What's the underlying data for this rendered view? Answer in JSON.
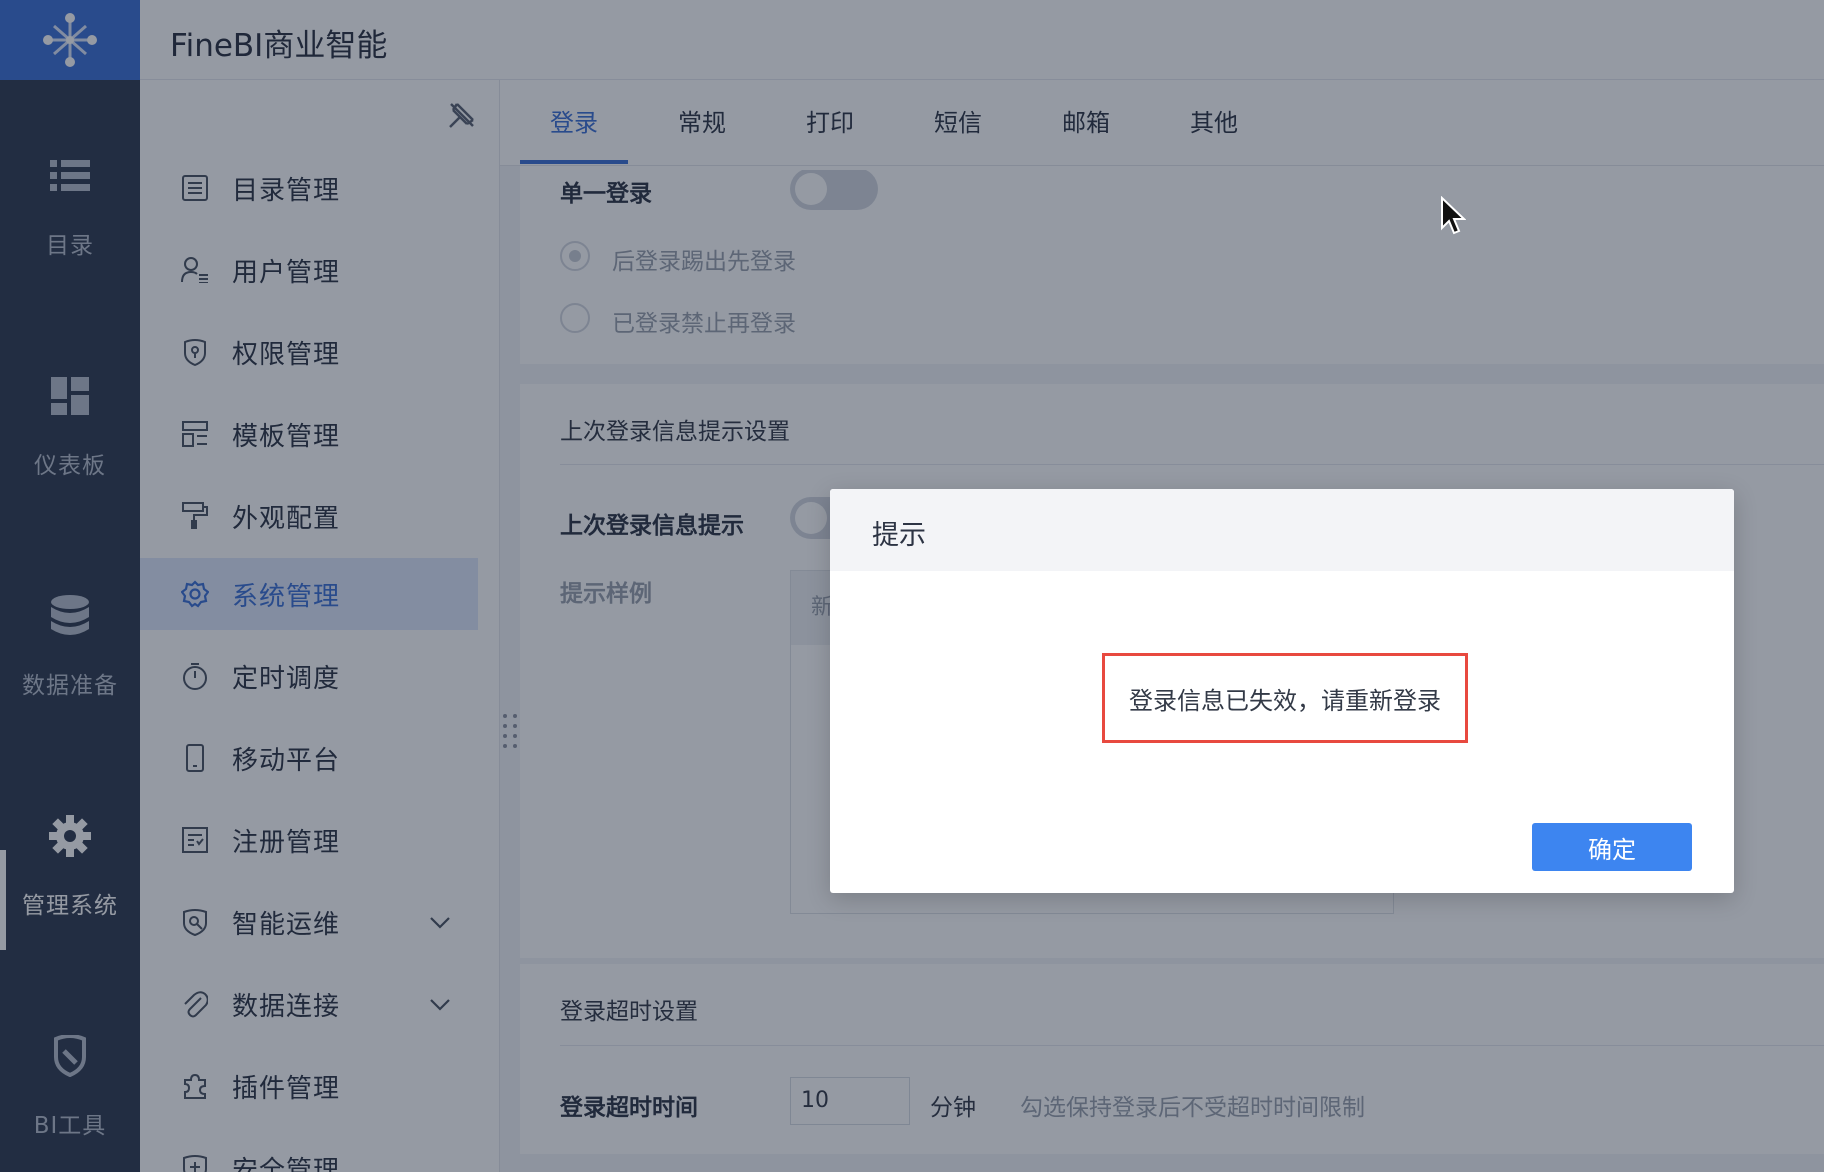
{
  "app": {
    "title": "FineBI商业智能"
  },
  "rail": {
    "items": [
      {
        "label": "目录",
        "icon": "list-icon"
      },
      {
        "label": "仪表板",
        "icon": "dashboard-icon"
      },
      {
        "label": "数据准备",
        "icon": "database-icon"
      },
      {
        "label": "管理系统",
        "icon": "gear-icon",
        "active": true
      },
      {
        "label": "BI工具",
        "icon": "tool-icon"
      }
    ]
  },
  "sidebar": {
    "items": [
      {
        "label": "目录管理",
        "icon": "list-icon"
      },
      {
        "label": "用户管理",
        "icon": "user-icon"
      },
      {
        "label": "权限管理",
        "icon": "shield-icon"
      },
      {
        "label": "模板管理",
        "icon": "template-icon"
      },
      {
        "label": "外观配置",
        "icon": "paint-roller-icon"
      },
      {
        "label": "系统管理",
        "icon": "gear-icon",
        "active": true
      },
      {
        "label": "定时调度",
        "icon": "timer-icon"
      },
      {
        "label": "移动平台",
        "icon": "mobile-icon"
      },
      {
        "label": "注册管理",
        "icon": "register-icon"
      },
      {
        "label": "智能运维",
        "icon": "ops-icon"
      },
      {
        "label": "数据连接",
        "icon": "paperclip-icon"
      },
      {
        "label": "插件管理",
        "icon": "puzzle-icon"
      },
      {
        "label": "安全管理",
        "icon": "shield-plus-icon"
      }
    ]
  },
  "tabs": [
    {
      "label": "登录",
      "active": true
    },
    {
      "label": "常规"
    },
    {
      "label": "打印"
    },
    {
      "label": "短信"
    },
    {
      "label": "邮箱"
    },
    {
      "label": "其他"
    }
  ],
  "single_login": {
    "label": "单一登录",
    "options": [
      "后登录踢出先登录",
      "已登录禁止再登录"
    ]
  },
  "last_login": {
    "section_title": "上次登录信息提示设置",
    "toggle_label": "上次登录信息提示",
    "sample_label": "提示样例",
    "sample_head": "新"
  },
  "timeout": {
    "section_title": "登录超时设置",
    "label": "登录超时时间",
    "value": "10",
    "unit": "分钟",
    "hint": "勾选保持登录后不受超时时间限制"
  },
  "dialog": {
    "title": "提示",
    "message": "登录信息已失效，请重新登录",
    "confirm_label": "确定"
  },
  "colors": {
    "accent": "#3b6fd6",
    "button": "#3d85f0",
    "highlight_border": "#e8493f",
    "rail": "#2f3a4f"
  }
}
